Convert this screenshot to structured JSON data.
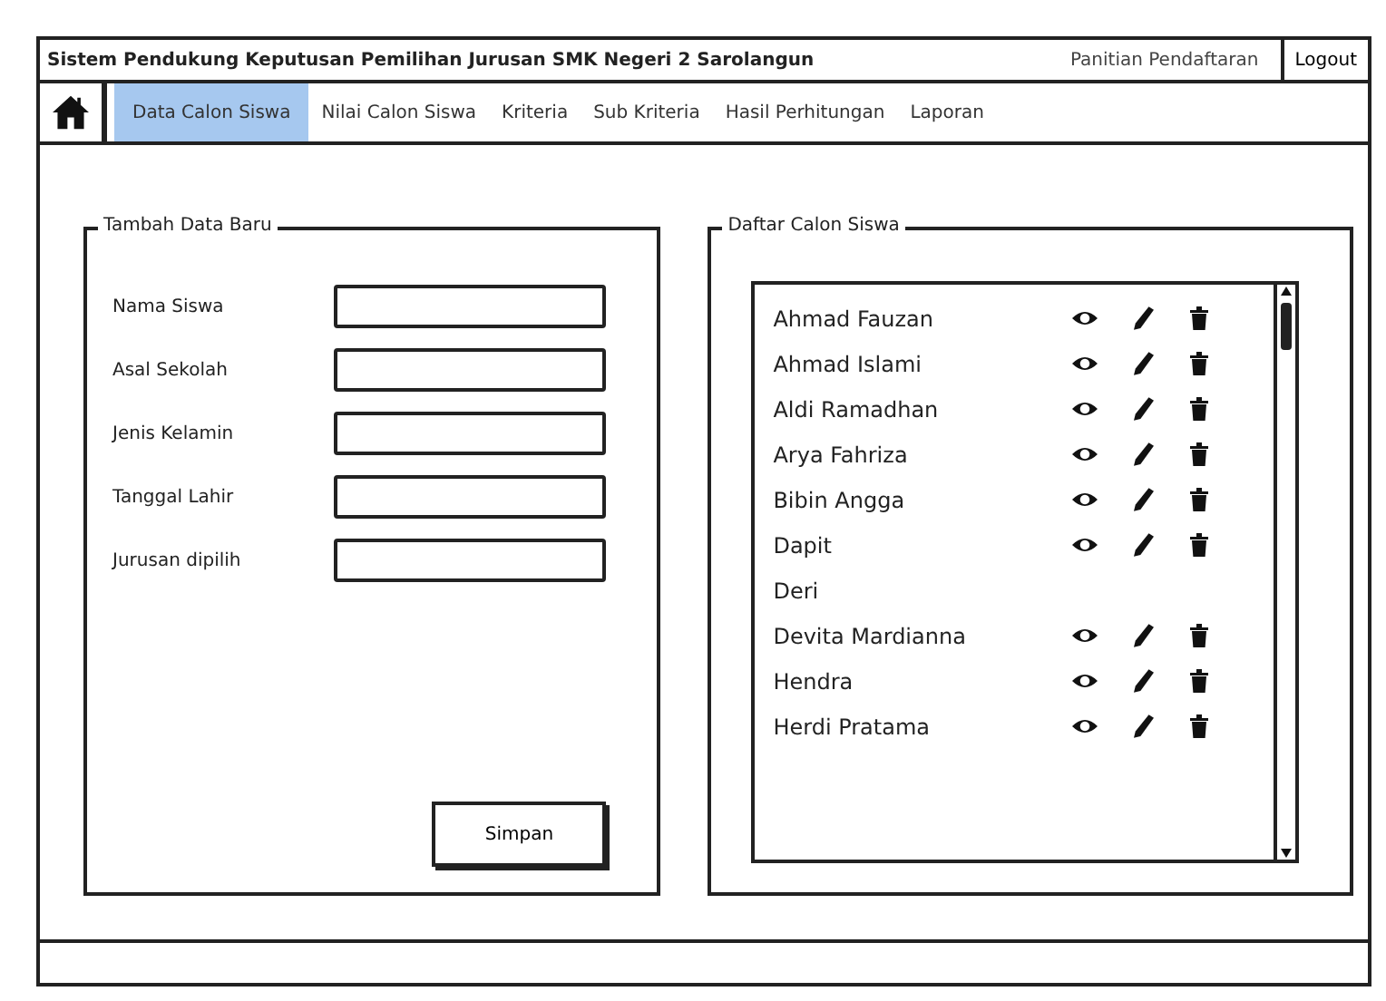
{
  "window": {
    "title": "Sistem Pendukung Keputusan Pemilihan Jurusan SMK Negeri 2 Sarolangun",
    "user": "Panitian Pendaftaran",
    "logout": "Logout"
  },
  "nav": [
    {
      "label": "Data Calon Siswa",
      "selected": true
    },
    {
      "label": "Nilai Calon Siswa",
      "selected": false
    },
    {
      "label": "Kriteria",
      "selected": false
    },
    {
      "label": "Sub Kriteria",
      "selected": false
    },
    {
      "label": "Hasil Perhitungan",
      "selected": false
    },
    {
      "label": "Laporan",
      "selected": false
    }
  ],
  "form": {
    "title": "Tambah Data Baru",
    "fields": [
      {
        "label": "Nama Siswa"
      },
      {
        "label": "Asal Sekolah"
      },
      {
        "label": "Jenis Kelamin"
      },
      {
        "label": "Tanggal Lahir"
      },
      {
        "label": "Jurusan dipilih"
      }
    ],
    "button": "Simpan"
  },
  "list": {
    "title": "Daftar Calon Siswa",
    "rows": [
      {
        "name": "Ahmad Fauzan",
        "actions": true
      },
      {
        "name": "Ahmad Islami",
        "actions": true
      },
      {
        "name": "Aldi Ramadhan",
        "actions": true
      },
      {
        "name": "Arya Fahriza",
        "actions": true
      },
      {
        "name": "Bibin Angga",
        "actions": true
      },
      {
        "name": "Dapit",
        "actions": true
      },
      {
        "name": "Deri",
        "actions": false
      },
      {
        "name": "Devita Mardianna",
        "actions": true
      },
      {
        "name": "Hendra",
        "actions": true
      },
      {
        "name": "Herdi Pratama",
        "actions": true
      }
    ]
  }
}
